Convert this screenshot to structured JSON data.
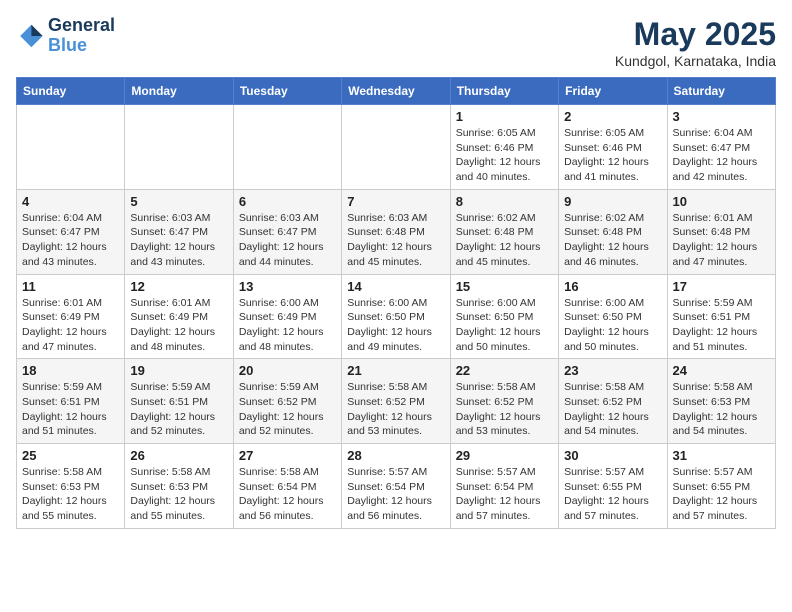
{
  "logo": {
    "line1": "General",
    "line2": "Blue"
  },
  "title": "May 2025",
  "location": "Kundgol, Karnataka, India",
  "days_of_week": [
    "Sunday",
    "Monday",
    "Tuesday",
    "Wednesday",
    "Thursday",
    "Friday",
    "Saturday"
  ],
  "weeks": [
    [
      {
        "num": "",
        "info": ""
      },
      {
        "num": "",
        "info": ""
      },
      {
        "num": "",
        "info": ""
      },
      {
        "num": "",
        "info": ""
      },
      {
        "num": "1",
        "info": "Sunrise: 6:05 AM\nSunset: 6:46 PM\nDaylight: 12 hours\nand 40 minutes."
      },
      {
        "num": "2",
        "info": "Sunrise: 6:05 AM\nSunset: 6:46 PM\nDaylight: 12 hours\nand 41 minutes."
      },
      {
        "num": "3",
        "info": "Sunrise: 6:04 AM\nSunset: 6:47 PM\nDaylight: 12 hours\nand 42 minutes."
      }
    ],
    [
      {
        "num": "4",
        "info": "Sunrise: 6:04 AM\nSunset: 6:47 PM\nDaylight: 12 hours\nand 43 minutes."
      },
      {
        "num": "5",
        "info": "Sunrise: 6:03 AM\nSunset: 6:47 PM\nDaylight: 12 hours\nand 43 minutes."
      },
      {
        "num": "6",
        "info": "Sunrise: 6:03 AM\nSunset: 6:47 PM\nDaylight: 12 hours\nand 44 minutes."
      },
      {
        "num": "7",
        "info": "Sunrise: 6:03 AM\nSunset: 6:48 PM\nDaylight: 12 hours\nand 45 minutes."
      },
      {
        "num": "8",
        "info": "Sunrise: 6:02 AM\nSunset: 6:48 PM\nDaylight: 12 hours\nand 45 minutes."
      },
      {
        "num": "9",
        "info": "Sunrise: 6:02 AM\nSunset: 6:48 PM\nDaylight: 12 hours\nand 46 minutes."
      },
      {
        "num": "10",
        "info": "Sunrise: 6:01 AM\nSunset: 6:48 PM\nDaylight: 12 hours\nand 47 minutes."
      }
    ],
    [
      {
        "num": "11",
        "info": "Sunrise: 6:01 AM\nSunset: 6:49 PM\nDaylight: 12 hours\nand 47 minutes."
      },
      {
        "num": "12",
        "info": "Sunrise: 6:01 AM\nSunset: 6:49 PM\nDaylight: 12 hours\nand 48 minutes."
      },
      {
        "num": "13",
        "info": "Sunrise: 6:00 AM\nSunset: 6:49 PM\nDaylight: 12 hours\nand 48 minutes."
      },
      {
        "num": "14",
        "info": "Sunrise: 6:00 AM\nSunset: 6:50 PM\nDaylight: 12 hours\nand 49 minutes."
      },
      {
        "num": "15",
        "info": "Sunrise: 6:00 AM\nSunset: 6:50 PM\nDaylight: 12 hours\nand 50 minutes."
      },
      {
        "num": "16",
        "info": "Sunrise: 6:00 AM\nSunset: 6:50 PM\nDaylight: 12 hours\nand 50 minutes."
      },
      {
        "num": "17",
        "info": "Sunrise: 5:59 AM\nSunset: 6:51 PM\nDaylight: 12 hours\nand 51 minutes."
      }
    ],
    [
      {
        "num": "18",
        "info": "Sunrise: 5:59 AM\nSunset: 6:51 PM\nDaylight: 12 hours\nand 51 minutes."
      },
      {
        "num": "19",
        "info": "Sunrise: 5:59 AM\nSunset: 6:51 PM\nDaylight: 12 hours\nand 52 minutes."
      },
      {
        "num": "20",
        "info": "Sunrise: 5:59 AM\nSunset: 6:52 PM\nDaylight: 12 hours\nand 52 minutes."
      },
      {
        "num": "21",
        "info": "Sunrise: 5:58 AM\nSunset: 6:52 PM\nDaylight: 12 hours\nand 53 minutes."
      },
      {
        "num": "22",
        "info": "Sunrise: 5:58 AM\nSunset: 6:52 PM\nDaylight: 12 hours\nand 53 minutes."
      },
      {
        "num": "23",
        "info": "Sunrise: 5:58 AM\nSunset: 6:52 PM\nDaylight: 12 hours\nand 54 minutes."
      },
      {
        "num": "24",
        "info": "Sunrise: 5:58 AM\nSunset: 6:53 PM\nDaylight: 12 hours\nand 54 minutes."
      }
    ],
    [
      {
        "num": "25",
        "info": "Sunrise: 5:58 AM\nSunset: 6:53 PM\nDaylight: 12 hours\nand 55 minutes."
      },
      {
        "num": "26",
        "info": "Sunrise: 5:58 AM\nSunset: 6:53 PM\nDaylight: 12 hours\nand 55 minutes."
      },
      {
        "num": "27",
        "info": "Sunrise: 5:58 AM\nSunset: 6:54 PM\nDaylight: 12 hours\nand 56 minutes."
      },
      {
        "num": "28",
        "info": "Sunrise: 5:57 AM\nSunset: 6:54 PM\nDaylight: 12 hours\nand 56 minutes."
      },
      {
        "num": "29",
        "info": "Sunrise: 5:57 AM\nSunset: 6:54 PM\nDaylight: 12 hours\nand 57 minutes."
      },
      {
        "num": "30",
        "info": "Sunrise: 5:57 AM\nSunset: 6:55 PM\nDaylight: 12 hours\nand 57 minutes."
      },
      {
        "num": "31",
        "info": "Sunrise: 5:57 AM\nSunset: 6:55 PM\nDaylight: 12 hours\nand 57 minutes."
      }
    ]
  ]
}
